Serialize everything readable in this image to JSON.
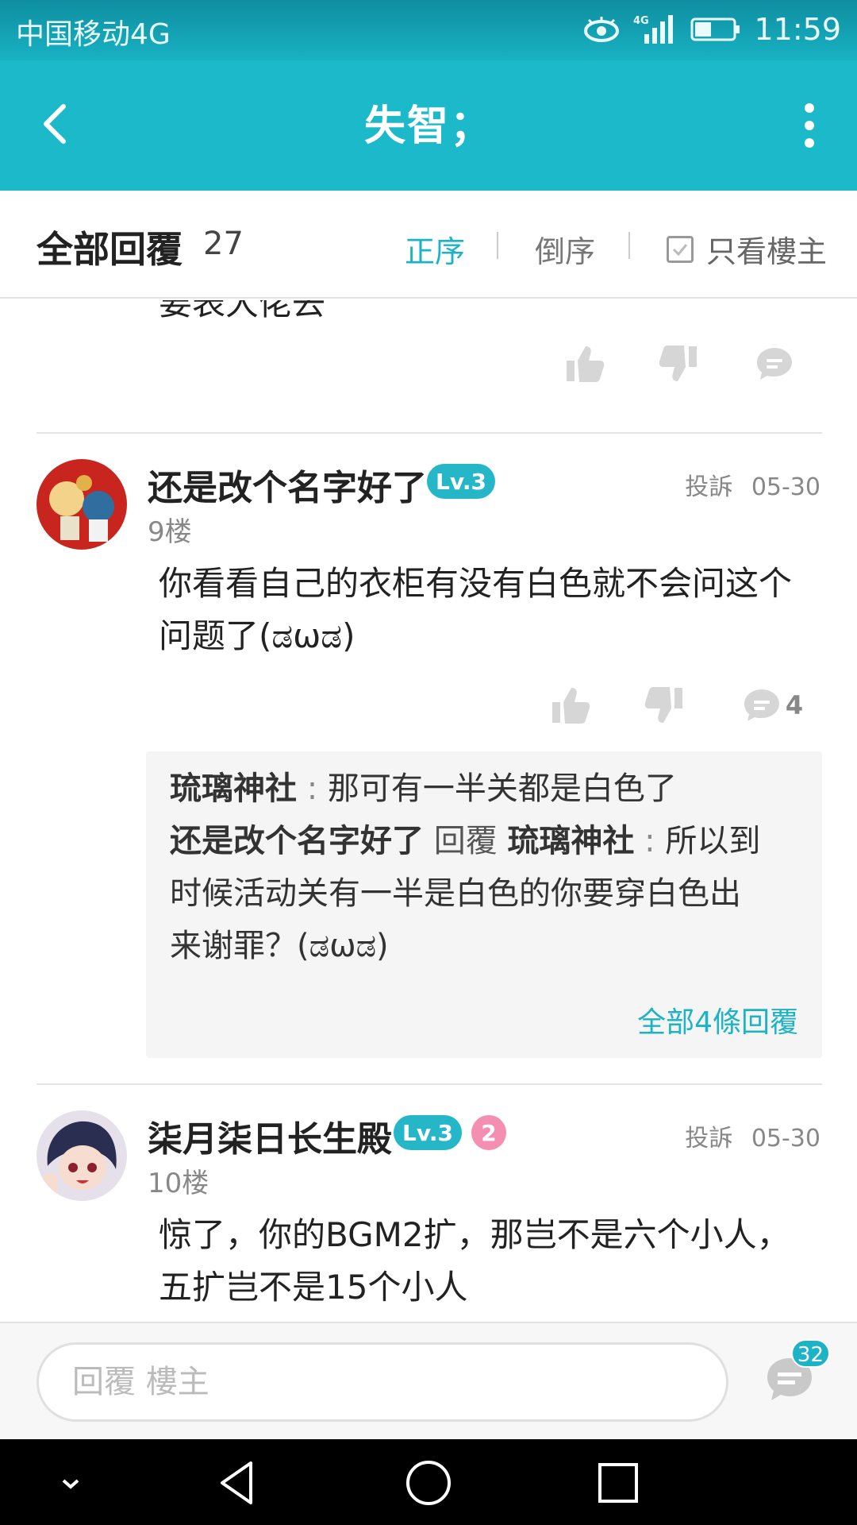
{
  "status": {
    "carrier": "中国移动4G",
    "time": "11:59",
    "network": "4G"
  },
  "appbar": {
    "title": "失智；"
  },
  "sort": {
    "label": "全部回覆",
    "count": "27",
    "asc": "正序",
    "desc": "倒序",
    "only_op": "只看樓主"
  },
  "prev_cut_text": "要表大佬去",
  "posts": [
    {
      "username": "还是改个名字好了",
      "level": "Lv.3",
      "report": "投訴",
      "date": "05-30",
      "floor": "9楼",
      "content_line1": "你看看自己的衣柜有没有白色就不会问这个",
      "content_line2": "问题了(ಡωಡ)",
      "reply_count": "4",
      "subreplies": {
        "r1_user": "琉璃神社",
        "r1_text": "那可有一半关都是白色了",
        "r2_user": "还是改个名字好了",
        "r2_reply_word": "回覆",
        "r2_target": "琉璃神社",
        "r2_text_1": "所以到",
        "r2_text_2": "时候活动关有一半是白色的你要穿白色出",
        "r2_text_3": "来谢罪？(ಡωಡ)",
        "more": "全部4條回覆"
      }
    },
    {
      "username": "柒月柒日长生殿",
      "level": "Lv.3",
      "badge2": "2",
      "report": "投訴",
      "date": "05-30",
      "floor": "10楼",
      "content_line1": "惊了，你的BGM2扩，那岂不是六个小人，",
      "content_line2": "五扩岂不是15个小人"
    }
  ],
  "bottom": {
    "placeholder": "回覆  樓主",
    "badge": "32"
  },
  "colors": {
    "accent": "#1bb9c9",
    "link": "#1bb3c5"
  }
}
